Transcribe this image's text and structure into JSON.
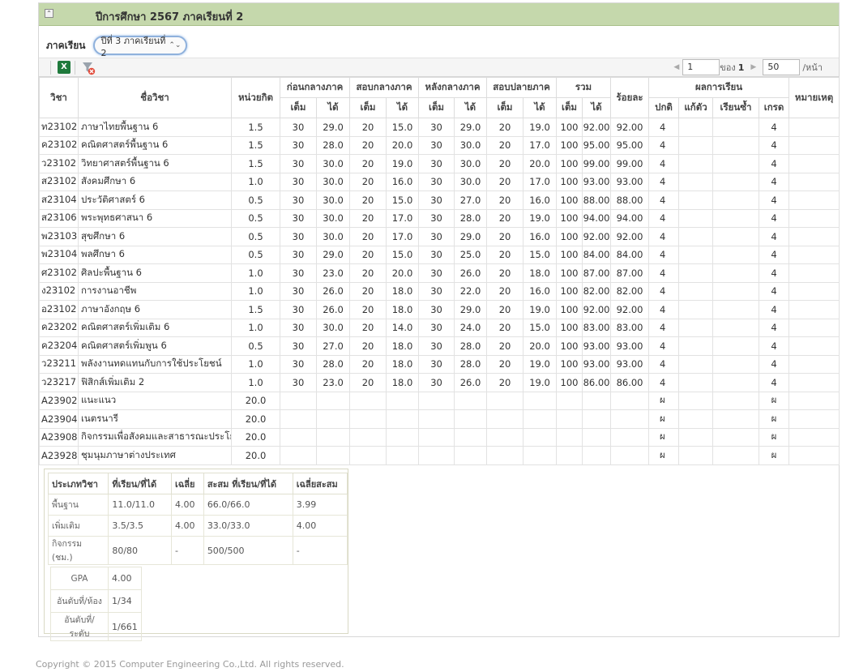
{
  "header": {
    "title": "ปีการศึกษา 2567 ภาคเรียนที่ 2",
    "collapse_glyph": "⌃"
  },
  "filter": {
    "label": "ภาคเรียน",
    "selected": "ปีที่ 3 ภาคเรียนที่ 2"
  },
  "toolbar": {
    "excel_glyph": "X"
  },
  "pager": {
    "page": "1",
    "of_label": "ของ",
    "total_pages": "1",
    "page_size": "50",
    "per_label": "/หน้า"
  },
  "columns": {
    "subject": "วิชา",
    "name": "ชื่อวิชา",
    "credit": "หน่วยกิต",
    "groups": [
      "ก่อนกลางภาค",
      "สอบกลางภาค",
      "หลังกลางภาค",
      "สอบปลายภาค",
      "รวม"
    ],
    "full": "เต็ม",
    "got": "ได้",
    "percent": "ร้อยละ",
    "result": "ผลการเรียน",
    "result_sub": [
      "ปกติ",
      "แก้ตัว",
      "เรียนซ้ำ",
      "เกรด"
    ],
    "remark": "หมายเหตุ"
  },
  "rows": [
    {
      "code": "ท23102",
      "name": "ภาษาไทยพื้นฐาน 6",
      "credit": "1.5",
      "c": [
        "30",
        "29.0",
        "20",
        "15.0",
        "30",
        "29.0",
        "20",
        "19.0",
        "100",
        "92.00"
      ],
      "pct": "92.00",
      "normal": "4",
      "fix": "",
      "repeat": "",
      "grade": "4"
    },
    {
      "code": "ค23102",
      "name": "คณิตศาสตร์พื้นฐาน 6",
      "credit": "1.5",
      "c": [
        "30",
        "28.0",
        "20",
        "20.0",
        "30",
        "30.0",
        "20",
        "17.0",
        "100",
        "95.00"
      ],
      "pct": "95.00",
      "normal": "4",
      "fix": "",
      "repeat": "",
      "grade": "4"
    },
    {
      "code": "ว23102",
      "name": "วิทยาศาสตร์พื้นฐาน 6",
      "credit": "1.5",
      "c": [
        "30",
        "30.0",
        "20",
        "19.0",
        "30",
        "30.0",
        "20",
        "20.0",
        "100",
        "99.00"
      ],
      "pct": "99.00",
      "normal": "4",
      "fix": "",
      "repeat": "",
      "grade": "4"
    },
    {
      "code": "ส23102",
      "name": "สังคมศึกษา 6",
      "credit": "1.0",
      "c": [
        "30",
        "30.0",
        "20",
        "16.0",
        "30",
        "30.0",
        "20",
        "17.0",
        "100",
        "93.00"
      ],
      "pct": "93.00",
      "normal": "4",
      "fix": "",
      "repeat": "",
      "grade": "4"
    },
    {
      "code": "ส23104",
      "name": "ประวัติศาสตร์ 6",
      "credit": "0.5",
      "c": [
        "30",
        "30.0",
        "20",
        "15.0",
        "30",
        "27.0",
        "20",
        "16.0",
        "100",
        "88.00"
      ],
      "pct": "88.00",
      "normal": "4",
      "fix": "",
      "repeat": "",
      "grade": "4"
    },
    {
      "code": "ส23106",
      "name": "พระพุทธศาสนา 6",
      "credit": "0.5",
      "c": [
        "30",
        "30.0",
        "20",
        "17.0",
        "30",
        "28.0",
        "20",
        "19.0",
        "100",
        "94.00"
      ],
      "pct": "94.00",
      "normal": "4",
      "fix": "",
      "repeat": "",
      "grade": "4"
    },
    {
      "code": "พ23103",
      "name": "สุขศึกษา 6",
      "credit": "0.5",
      "c": [
        "30",
        "30.0",
        "20",
        "17.0",
        "30",
        "29.0",
        "20",
        "16.0",
        "100",
        "92.00"
      ],
      "pct": "92.00",
      "normal": "4",
      "fix": "",
      "repeat": "",
      "grade": "4"
    },
    {
      "code": "พ23104",
      "name": "พลศึกษา 6",
      "credit": "0.5",
      "c": [
        "30",
        "29.0",
        "20",
        "15.0",
        "30",
        "25.0",
        "20",
        "15.0",
        "100",
        "84.00"
      ],
      "pct": "84.00",
      "normal": "4",
      "fix": "",
      "repeat": "",
      "grade": "4"
    },
    {
      "code": "ศ23102",
      "name": "ศิลปะพื้นฐาน 6",
      "credit": "1.0",
      "c": [
        "30",
        "23.0",
        "20",
        "20.0",
        "30",
        "26.0",
        "20",
        "18.0",
        "100",
        "87.00"
      ],
      "pct": "87.00",
      "normal": "4",
      "fix": "",
      "repeat": "",
      "grade": "4"
    },
    {
      "code": "ง23102",
      "name": "การงานอาชีพ",
      "credit": "1.0",
      "c": [
        "30",
        "26.0",
        "20",
        "18.0",
        "30",
        "22.0",
        "20",
        "16.0",
        "100",
        "82.00"
      ],
      "pct": "82.00",
      "normal": "4",
      "fix": "",
      "repeat": "",
      "grade": "4"
    },
    {
      "code": "อ23102",
      "name": "ภาษาอังกฤษ 6",
      "credit": "1.5",
      "c": [
        "30",
        "26.0",
        "20",
        "18.0",
        "30",
        "29.0",
        "20",
        "19.0",
        "100",
        "92.00"
      ],
      "pct": "92.00",
      "normal": "4",
      "fix": "",
      "repeat": "",
      "grade": "4"
    },
    {
      "code": "ค23202",
      "name": "คณิตศาสตร์เพิ่มเติม 6",
      "credit": "1.0",
      "c": [
        "30",
        "30.0",
        "20",
        "14.0",
        "30",
        "24.0",
        "20",
        "15.0",
        "100",
        "83.00"
      ],
      "pct": "83.00",
      "normal": "4",
      "fix": "",
      "repeat": "",
      "grade": "4"
    },
    {
      "code": "ค23204",
      "name": "คณิตศาสตร์เพิ่มพูน 6",
      "credit": "0.5",
      "c": [
        "30",
        "27.0",
        "20",
        "18.0",
        "30",
        "28.0",
        "20",
        "20.0",
        "100",
        "93.00"
      ],
      "pct": "93.00",
      "normal": "4",
      "fix": "",
      "repeat": "",
      "grade": "4"
    },
    {
      "code": "ว23211",
      "name": "พลังงานทดแทนกับการใช้ประโยชน์",
      "credit": "1.0",
      "c": [
        "30",
        "28.0",
        "20",
        "18.0",
        "30",
        "28.0",
        "20",
        "19.0",
        "100",
        "93.00"
      ],
      "pct": "93.00",
      "normal": "4",
      "fix": "",
      "repeat": "",
      "grade": "4"
    },
    {
      "code": "ว23217",
      "name": "ฟิสิกส์เพิ่มเติม 2",
      "credit": "1.0",
      "c": [
        "30",
        "23.0",
        "20",
        "18.0",
        "30",
        "26.0",
        "20",
        "19.0",
        "100",
        "86.00"
      ],
      "pct": "86.00",
      "normal": "4",
      "fix": "",
      "repeat": "",
      "grade": "4"
    },
    {
      "code": "A23902",
      "name": "แนะแนว",
      "credit": "20.0",
      "c": [
        "",
        "",
        "",
        "",
        "",
        "",
        "",
        "",
        "",
        ""
      ],
      "pct": "",
      "normal": "ผ",
      "fix": "",
      "repeat": "",
      "grade": "ผ"
    },
    {
      "code": "A23904",
      "name": "เนตรนารี",
      "credit": "20.0",
      "c": [
        "",
        "",
        "",
        "",
        "",
        "",
        "",
        "",
        "",
        ""
      ],
      "pct": "",
      "normal": "ผ",
      "fix": "",
      "repeat": "",
      "grade": "ผ"
    },
    {
      "code": "A23908",
      "name": "กิจกรรมเพื่อสังคมและสาธารณะประโยชน์",
      "credit": "20.0",
      "c": [
        "",
        "",
        "",
        "",
        "",
        "",
        "",
        "",
        "",
        ""
      ],
      "pct": "",
      "normal": "ผ",
      "fix": "",
      "repeat": "",
      "grade": "ผ"
    },
    {
      "code": "A23928",
      "name": "ชุมนุมภาษาต่างประเทศ",
      "credit": "20.0",
      "c": [
        "",
        "",
        "",
        "",
        "",
        "",
        "",
        "",
        "",
        ""
      ],
      "pct": "",
      "normal": "ผ",
      "fix": "",
      "repeat": "",
      "grade": "ผ"
    }
  ],
  "summary": {
    "headers": [
      "ประเภทวิชา",
      "ที่เรียน/ที่ได้",
      "เฉลี่ย",
      "สะสม ที่เรียน/ที่ได้",
      "เฉลี่ยสะสม"
    ],
    "rows": [
      {
        "type": "พื้นฐาน",
        "studied": "11.0/11.0",
        "avg": "4.00",
        "accum": "66.0/66.0",
        "accum_avg": "3.99"
      },
      {
        "type": "เพิ่มเติม",
        "studied": "3.5/3.5",
        "avg": "4.00",
        "accum": "33.0/33.0",
        "accum_avg": "4.00"
      },
      {
        "type": "กิจกรรม (ชม.)",
        "studied": "80/80",
        "avg": "-",
        "accum": "500/500",
        "accum_avg": "-"
      }
    ],
    "gpa": [
      {
        "label": "GPA",
        "value": "4.00"
      },
      {
        "label": "อันดับที่/ห้อง",
        "value": "1/34"
      },
      {
        "label": "อันดับที่/ระดับ",
        "value": "1/661"
      }
    ]
  },
  "footer": {
    "copyright": "Copyright © 2015 Computer Engineering Co.,Ltd. All rights reserved."
  }
}
